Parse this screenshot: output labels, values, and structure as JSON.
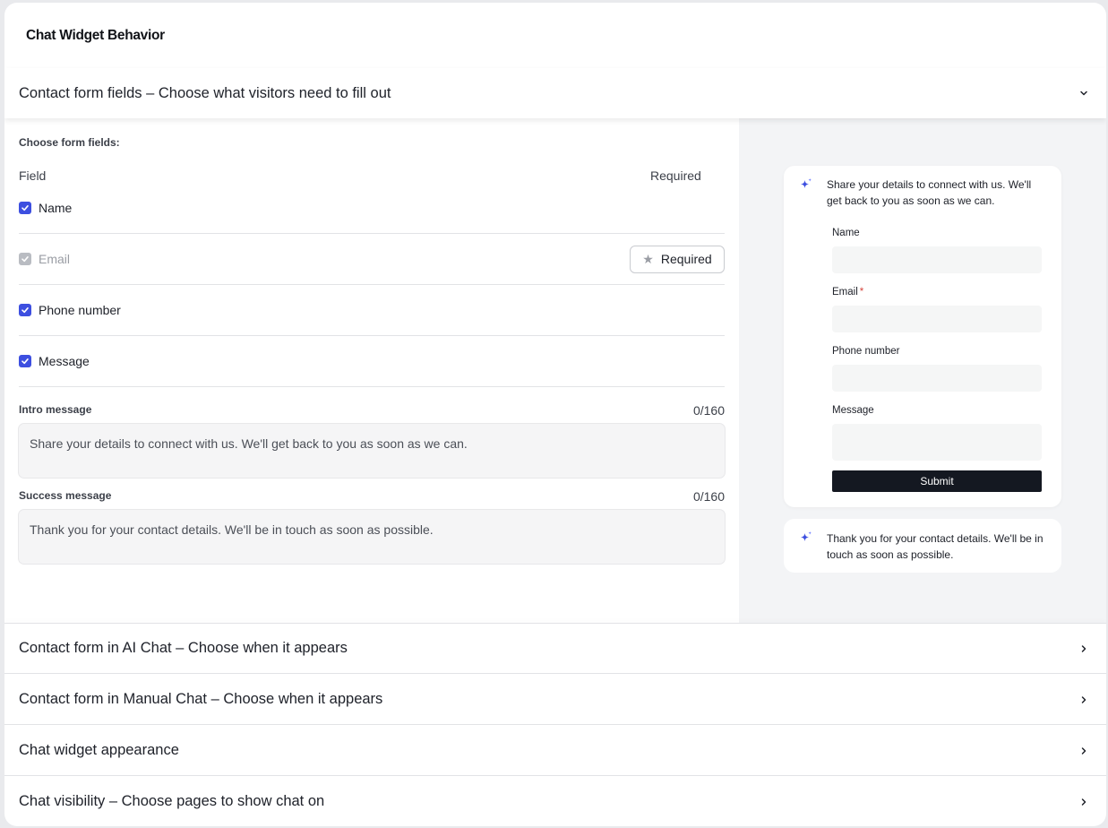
{
  "card": {
    "title": "Chat Widget Behavior"
  },
  "open_section": {
    "label": "Contact form fields – Choose what visitors need to fill out",
    "choose_label": "Choose form fields:",
    "col_field": "Field",
    "col_required": "Required",
    "fields": [
      {
        "name": "Name",
        "checked": true,
        "disabled": false
      },
      {
        "name": "Email",
        "checked": true,
        "disabled": true,
        "required_label": "Required"
      },
      {
        "name": "Phone number",
        "checked": true,
        "disabled": false
      },
      {
        "name": "Message",
        "checked": true,
        "disabled": false
      }
    ],
    "intro": {
      "label": "Intro message",
      "count": "0/160",
      "value": "Share your details to connect with us. We'll get back to you as soon as we can."
    },
    "success": {
      "label": "Success message",
      "count": "0/160",
      "value": "Thank you for your contact details. We'll be in touch as soon as possible."
    }
  },
  "preview": {
    "intro": "Share your details to connect with us. We'll get back to you as soon as we can.",
    "fields": [
      "Name",
      "Email",
      "Phone number",
      "Message"
    ],
    "required_marker": "*",
    "submit": "Submit",
    "success": "Thank you for your contact details. We'll be in touch as soon as possible."
  },
  "collapsed_sections": [
    {
      "label": "Contact form in AI Chat – Choose when it appears"
    },
    {
      "label": "Contact form in Manual Chat – Choose when it appears"
    },
    {
      "label": "Chat widget appearance"
    },
    {
      "label": "Chat visibility – Choose pages to show chat on"
    }
  ],
  "colors": {
    "accent": "#3d4fe0",
    "submit_bg": "#141821",
    "required_asterisk": "#d6453d",
    "preview_bg": "#f3f4f6"
  },
  "icons": [
    "chevron-down-icon",
    "chevron-right-icon",
    "check-icon",
    "star-icon",
    "sparkle-icon"
  ]
}
